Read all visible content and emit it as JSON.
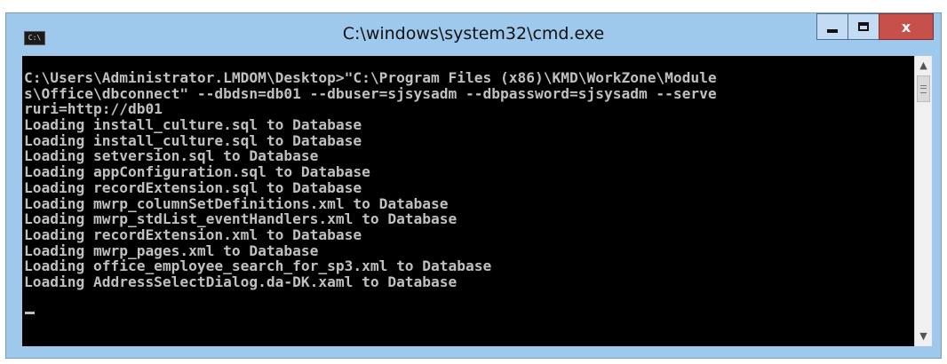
{
  "window": {
    "title": "C:\\windows\\system32\\cmd.exe",
    "system_icon_label": "C:\\",
    "controls": {
      "minimize": "",
      "maximize": "",
      "close": "x"
    }
  },
  "console": {
    "lines": [
      "C:\\Users\\Administrator.LMDOM\\Desktop>\"C:\\Program Files (x86)\\KMD\\WorkZone\\Module",
      "s\\Office\\dbconnect\" --dbdsn=db01 --dbuser=sjsysadm --dbpassword=sjsysadm --serve",
      "ruri=http://db01",
      "Loading install_culture.sql to Database",
      "Loading install_culture.sql to Database",
      "Loading setversion.sql to Database",
      "Loading appConfiguration.sql to Database",
      "Loading recordExtension.sql to Database",
      "Loading mwrp_columnSetDefinitions.xml to Database",
      "Loading mwrp_stdList_eventHandlers.xml to Database",
      "Loading recordExtension.xml to Database",
      "Loading mwrp_pages.xml to Database",
      "Loading office_employee_search_for_sp3.xml to Database",
      "Loading AddressSelectDialog.da-DK.xaml to Database"
    ]
  },
  "scrollbar": {
    "up_icon": "scroll-up-arrow",
    "down_icon": "scroll-down-arrow"
  },
  "colors": {
    "console_bg": "#000000",
    "console_fg": "#c0c0c0",
    "frame": "#9fc9ec",
    "close": "#c7504a"
  }
}
